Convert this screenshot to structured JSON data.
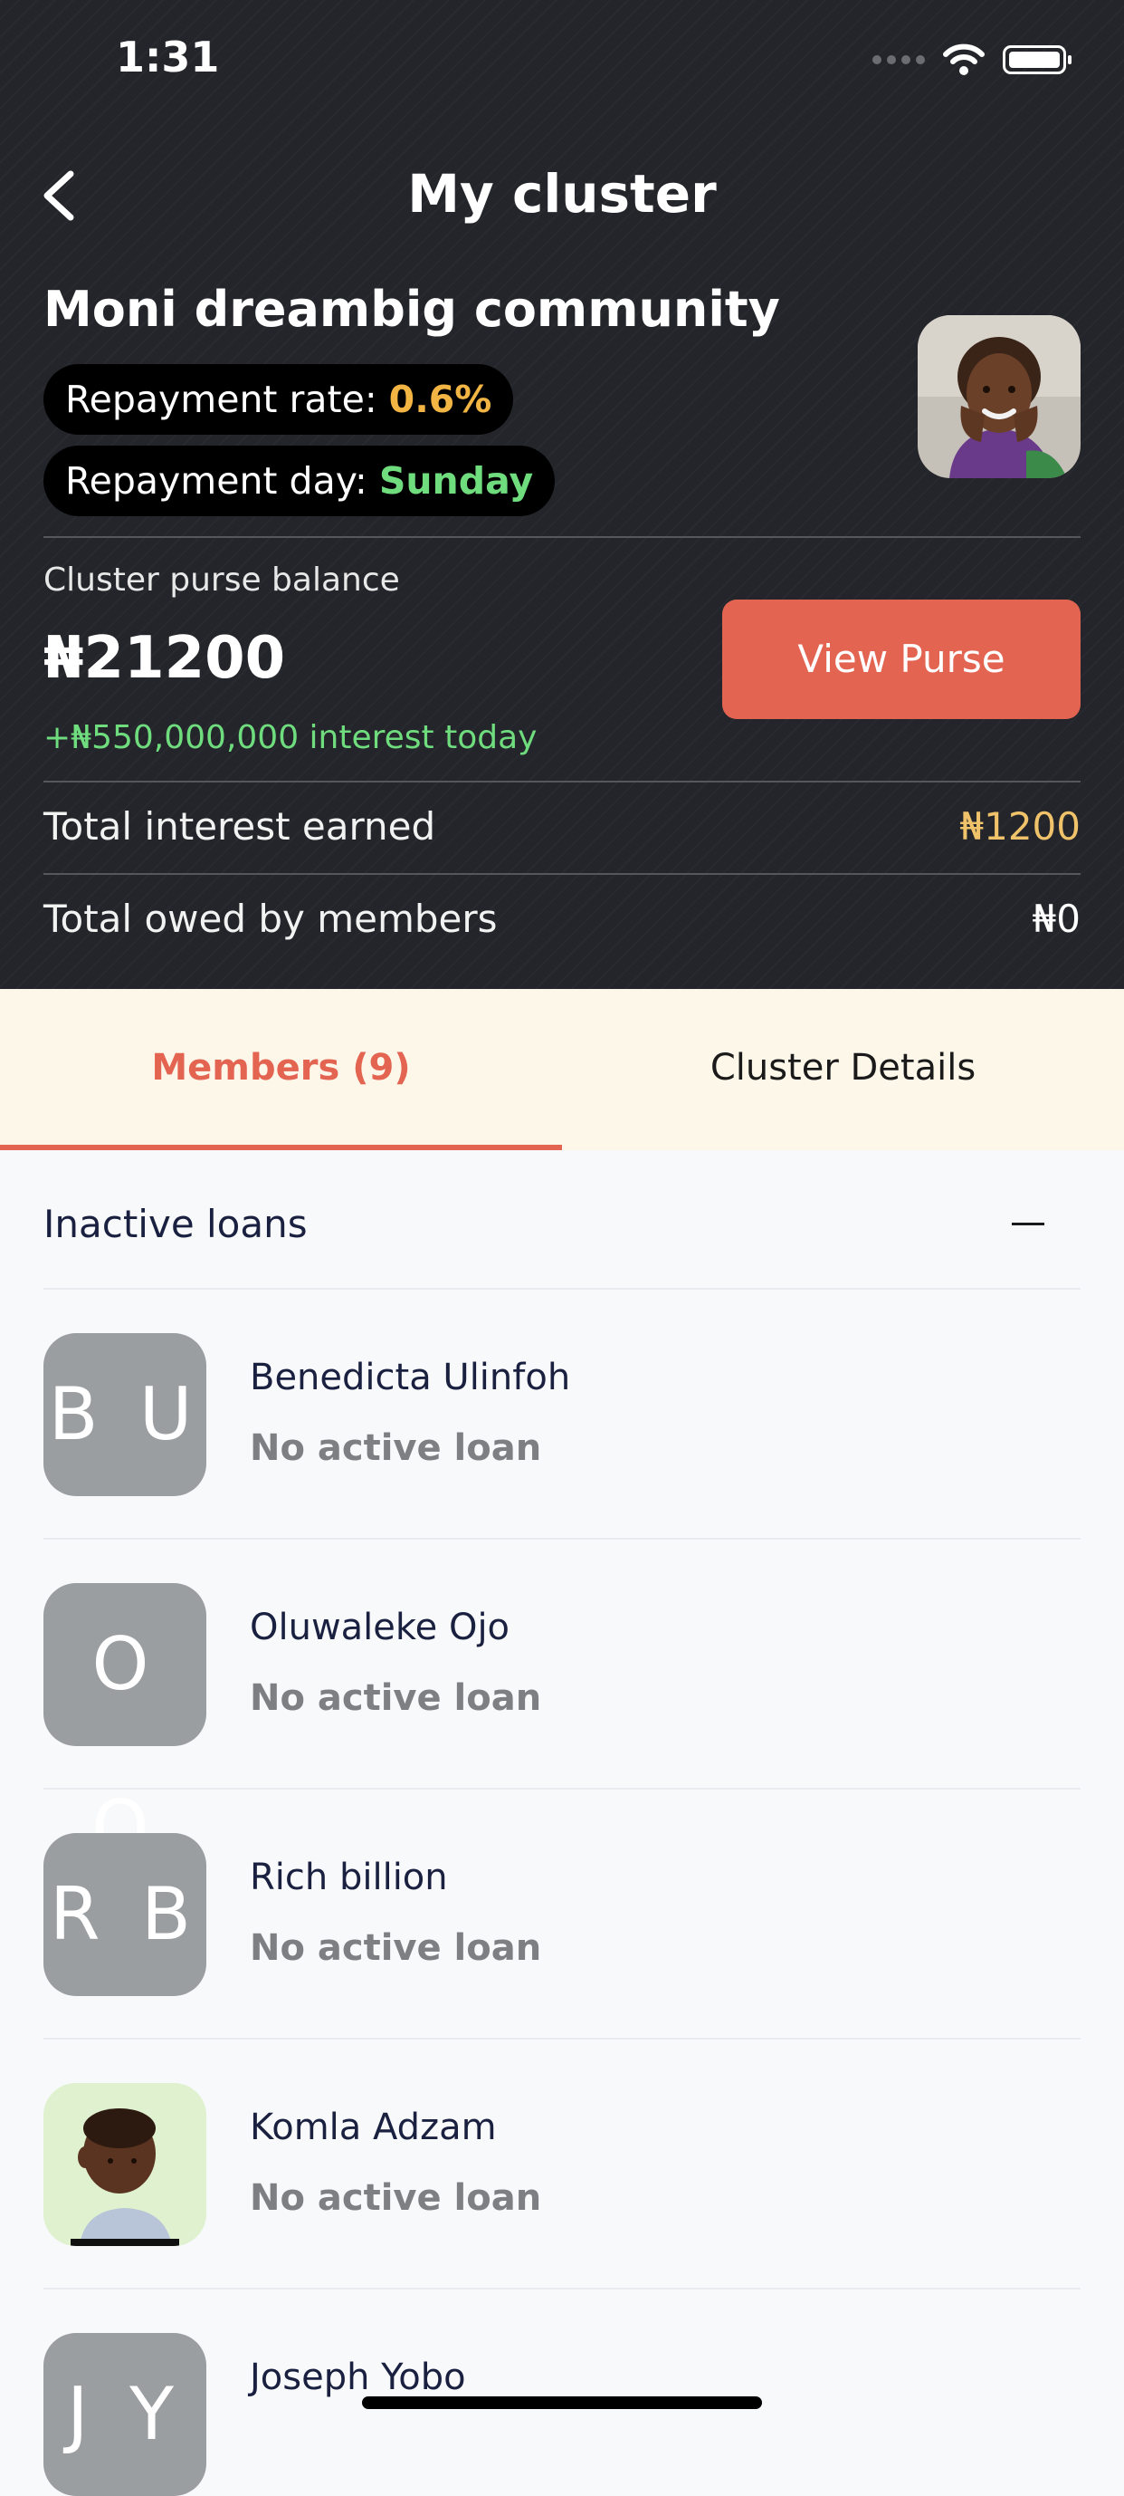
{
  "status_bar": {
    "time": "1:31"
  },
  "header": {
    "title": "My cluster",
    "cluster_name": "Moni dreambig community",
    "repayment_rate": {
      "label": "Repayment rate: ",
      "value": "0.6%"
    },
    "repayment_day": {
      "label": "Repayment day: ",
      "value": "Sunday"
    }
  },
  "purse": {
    "label": "Cluster purse balance",
    "amount": "₦21200",
    "interest_today": "+₦550,000,000 interest today",
    "button_label": "View Purse"
  },
  "summary": {
    "interest_label": "Total interest earned",
    "interest_value": "₦1200",
    "owed_label": "Total owed by members",
    "owed_value": "₦0"
  },
  "tabs": [
    {
      "label": "Members (9)",
      "active": true
    },
    {
      "label": "Cluster Details",
      "active": false
    }
  ],
  "section": {
    "title": "Inactive loans"
  },
  "members": [
    {
      "initials": "B U",
      "name": "Benedicta Ulinfoh",
      "status": "No active loan"
    },
    {
      "initials": "O O",
      "name": "Oluwaleke Ojo",
      "status": "No active loan"
    },
    {
      "initials": "R B",
      "name": "Rich billion",
      "status": "No active loan"
    },
    {
      "initials": "",
      "name": "Komla Adzam",
      "status": "No active loan"
    },
    {
      "initials": "J Y",
      "name": "Joseph Yobo",
      "status": ""
    }
  ],
  "colors": {
    "accent": "#e46452",
    "header_bg": "#23252a",
    "rate_highlight": "#f2b544",
    "day_highlight": "#6fdc7e",
    "interest_value": "#f0c36b",
    "avatar_gray": "#9a9ea1"
  }
}
